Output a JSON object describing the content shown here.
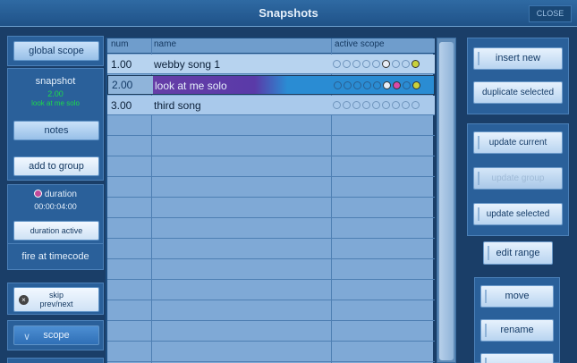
{
  "window": {
    "title": "Snapshots",
    "close_label": "CLOSE"
  },
  "left": {
    "global_scope": "global scope",
    "snapshot_label": "snapshot",
    "snapshot_num": "2.00",
    "snapshot_name": "look at me solo",
    "notes": "notes",
    "add_to_group": "add to group",
    "duration_label": "duration",
    "duration_value": "00:00:04:00",
    "duration_active": "duration active",
    "fire_at_timecode": "fire at timecode",
    "skip_line1": "skip",
    "skip_line2": "prev/next",
    "scope": "scope"
  },
  "table": {
    "headers": {
      "num": "num",
      "name": "name",
      "active_scope": "active scope"
    },
    "rows": [
      {
        "num": "1.00",
        "name": "webby song 1"
      },
      {
        "num": "2.00",
        "name": "look at me solo"
      },
      {
        "num": "3.00",
        "name": "third song"
      }
    ]
  },
  "right": {
    "insert_new": "insert new",
    "duplicate_selected": "duplicate selected",
    "update_current": "update current",
    "update_group": "update group",
    "update_selected": "update selected",
    "edit_range": "edit range",
    "move": "move",
    "rename": "rename"
  },
  "colors": {
    "accent_purple": "#6b3fa6",
    "accent_green": "#1dd84c",
    "bg": "#1a3e68"
  }
}
